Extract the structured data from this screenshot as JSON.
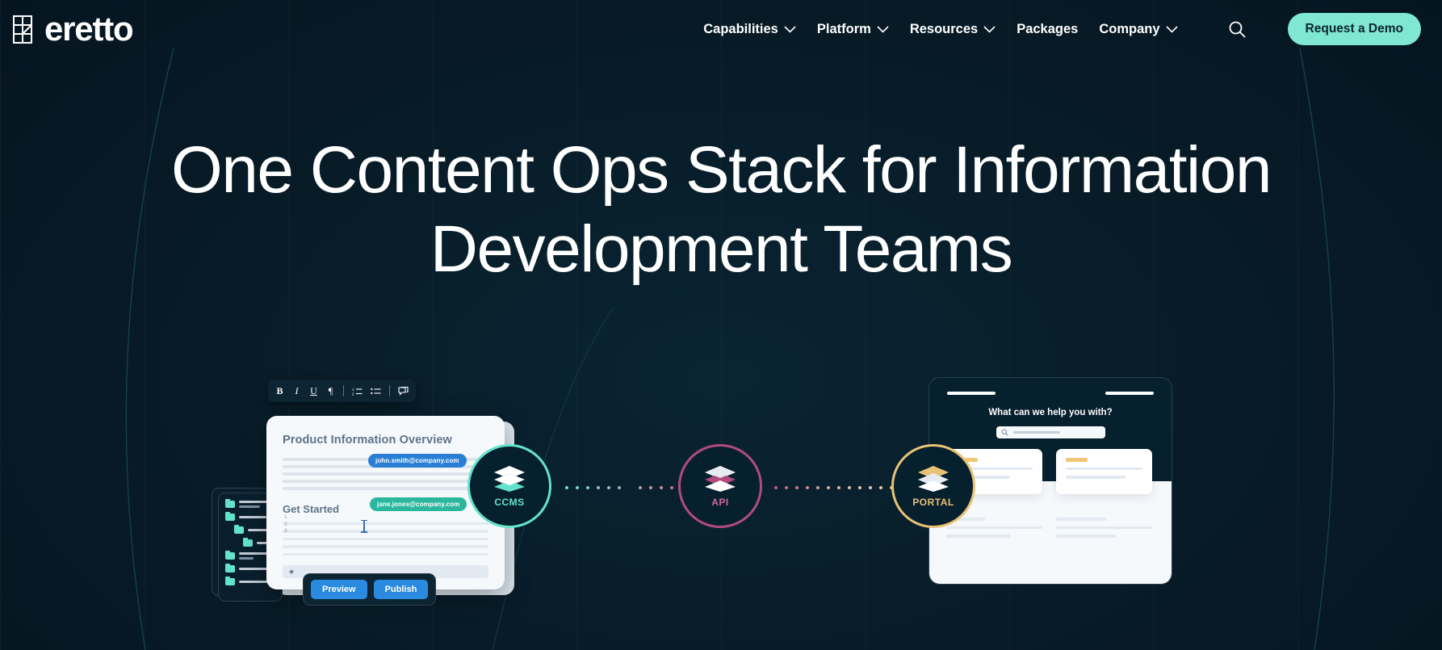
{
  "brand": {
    "name": "eretto",
    "logo_icon": "heretto-grid-logo"
  },
  "header": {
    "nav": [
      {
        "label": "Capabilities",
        "has_dropdown": true,
        "icon": "chevron-down-icon"
      },
      {
        "label": "Platform",
        "has_dropdown": true,
        "icon": "chevron-down-icon"
      },
      {
        "label": "Resources",
        "has_dropdown": true,
        "icon": "chevron-down-icon"
      },
      {
        "label": "Packages",
        "has_dropdown": false,
        "icon": ""
      },
      {
        "label": "Company",
        "has_dropdown": true,
        "icon": "chevron-down-icon"
      }
    ],
    "search_icon": "search-icon",
    "cta_label": "Request a Demo"
  },
  "hero": {
    "line1": "One Content Ops Stack for Information",
    "line2": "Development Teams"
  },
  "illustration": {
    "editor": {
      "toolbar": [
        {
          "label": "B",
          "icon": "bold-icon"
        },
        {
          "label": "I",
          "icon": "italic-icon"
        },
        {
          "label": "U",
          "icon": "underline-icon"
        },
        {
          "label": "¶",
          "icon": "paragraph-icon"
        },
        {
          "label": "",
          "icon": "numbered-list-icon"
        },
        {
          "label": "",
          "icon": "bullet-list-icon"
        },
        {
          "label": "",
          "icon": "comment-icon"
        }
      ],
      "document_title": "Product Information Overview",
      "section_heading": "Get Started",
      "list_numbers": [
        "1",
        "2",
        "3"
      ],
      "comment_chips": [
        {
          "text": "john.smith@company.com",
          "color": "#2a7fd4"
        },
        {
          "text": "jane.jones@company.com",
          "color": "#2bb79e"
        }
      ],
      "actions": [
        {
          "label": "Preview"
        },
        {
          "label": "Publish"
        }
      ]
    },
    "nodes": [
      {
        "label": "CCMS",
        "color": "#63e3cc",
        "icon": "layers-icon"
      },
      {
        "label": "API",
        "color": "#d16a9b",
        "ring": "#b04b7e",
        "icon": "layers-icon"
      },
      {
        "label": "PORTAL",
        "color": "#e8c275",
        "icon": "layers-icon"
      }
    ],
    "portal": {
      "question": "What can we help you with?",
      "search_icon": "search-icon"
    }
  },
  "colors": {
    "background": "#07202e",
    "accent_mint": "#7fe7d2",
    "accent_magenta": "#b04b7e",
    "accent_amber": "#e8c275",
    "button_blue": "#2a8ae0",
    "text_primary": "#ffffff"
  }
}
